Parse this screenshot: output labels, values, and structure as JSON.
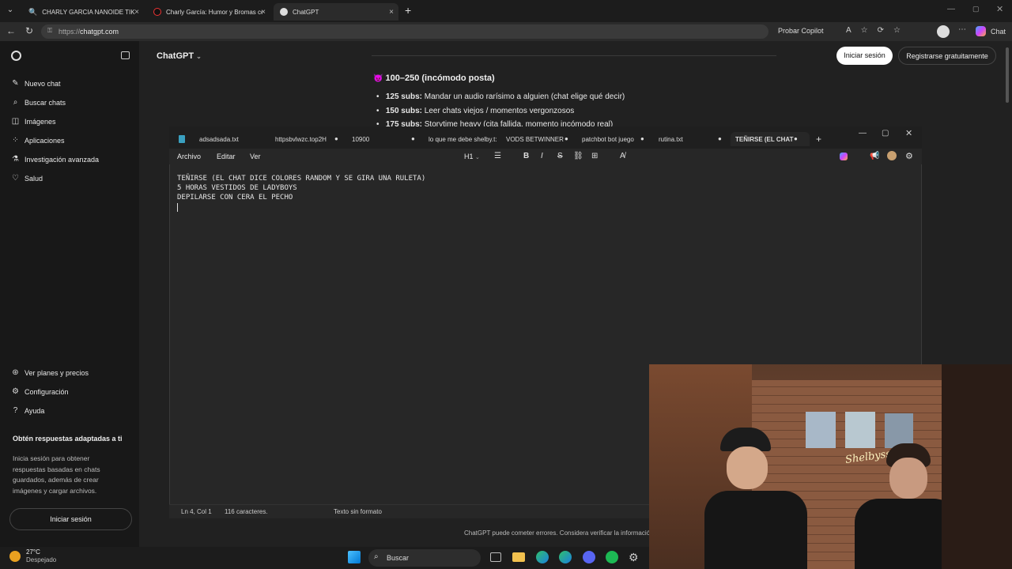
{
  "browser": {
    "tabs": [
      {
        "label": "CHARLY GARCIA NANOIDE TIKTOK"
      },
      {
        "label": "Charly García: Humor y Bromas co"
      },
      {
        "label": "ChatGPT"
      }
    ],
    "url_prefix": "https://",
    "url_host": "chatgpt.com",
    "copilot_label": "Probar Copilot",
    "chat_label": "Chat"
  },
  "chatgpt": {
    "model_label": "ChatGPT",
    "login_button": "Iniciar sesión",
    "signup_button": "Registrarse gratuitamente",
    "sidebar": {
      "items": [
        {
          "label": "Nuevo chat",
          "icon": "edit-icon"
        },
        {
          "label": "Buscar chats",
          "icon": "search-icon"
        },
        {
          "label": "Imágenes",
          "icon": "image-icon"
        },
        {
          "label": "Aplicaciones",
          "icon": "apps-icon"
        },
        {
          "label": "Investigación avanzada",
          "icon": "research-icon"
        },
        {
          "label": "Salud",
          "icon": "heart-icon"
        }
      ],
      "bottom_items": [
        {
          "label": "Ver planes y precios"
        },
        {
          "label": "Configuración"
        },
        {
          "label": "Ayuda"
        }
      ],
      "promo_title": "Obtén respuestas adaptadas a ti",
      "promo_text": "Inicia sesión para obtener respuestas basadas en chats guardados, además de crear imágenes y cargar archivos.",
      "login_button": "Iniciar sesión"
    },
    "content": {
      "heading_emoji": "😈",
      "heading": "100–250 (incómodo posta)",
      "bullets": [
        {
          "bold": "125 subs:",
          "text": " Mandar un audio rarísimo a alguien (chat elige qué decir)"
        },
        {
          "bold": "150 subs:",
          "text": " Leer chats viejos / momentos vergonzosos"
        },
        {
          "bold": "175 subs:",
          "text": " Storytime heavy (cita fallida, momento incómodo real)"
        }
      ]
    },
    "footer": "ChatGPT puede cometer errores. Considera verificar la información"
  },
  "notepad": {
    "tabs": [
      {
        "label": "adsadsada.txt"
      },
      {
        "label": "httpsbvlwzc.top2H"
      },
      {
        "label": "10900"
      },
      {
        "label": "lo que me debe shelby.t:"
      },
      {
        "label": "VODS BETWINNER"
      },
      {
        "label": "patchbot bot juego"
      },
      {
        "label": "rutina.txt"
      },
      {
        "label": "TEÑIRSE (EL CHAT"
      }
    ],
    "menu": {
      "file": "Archivo",
      "edit": "Editar",
      "view": "Ver"
    },
    "heading_select": "H1",
    "lines": [
      "TEÑIRSE (EL CHAT DICE COLORES RANDOM Y SE GIRA UNA RULETA)",
      "5 HORAS VESTIDOS DE LADYBOYS",
      "DEPILARSE CON CERA EL PECHO"
    ],
    "status": {
      "position": "Ln 4, Col 1",
      "chars": "116 caracteres.",
      "format": "Texto sin formato"
    }
  },
  "taskbar": {
    "temperature": "27°C",
    "weather": "Despejado",
    "search_placeholder": "Buscar"
  },
  "webcam": {
    "neon_text": "Shelbyss"
  }
}
